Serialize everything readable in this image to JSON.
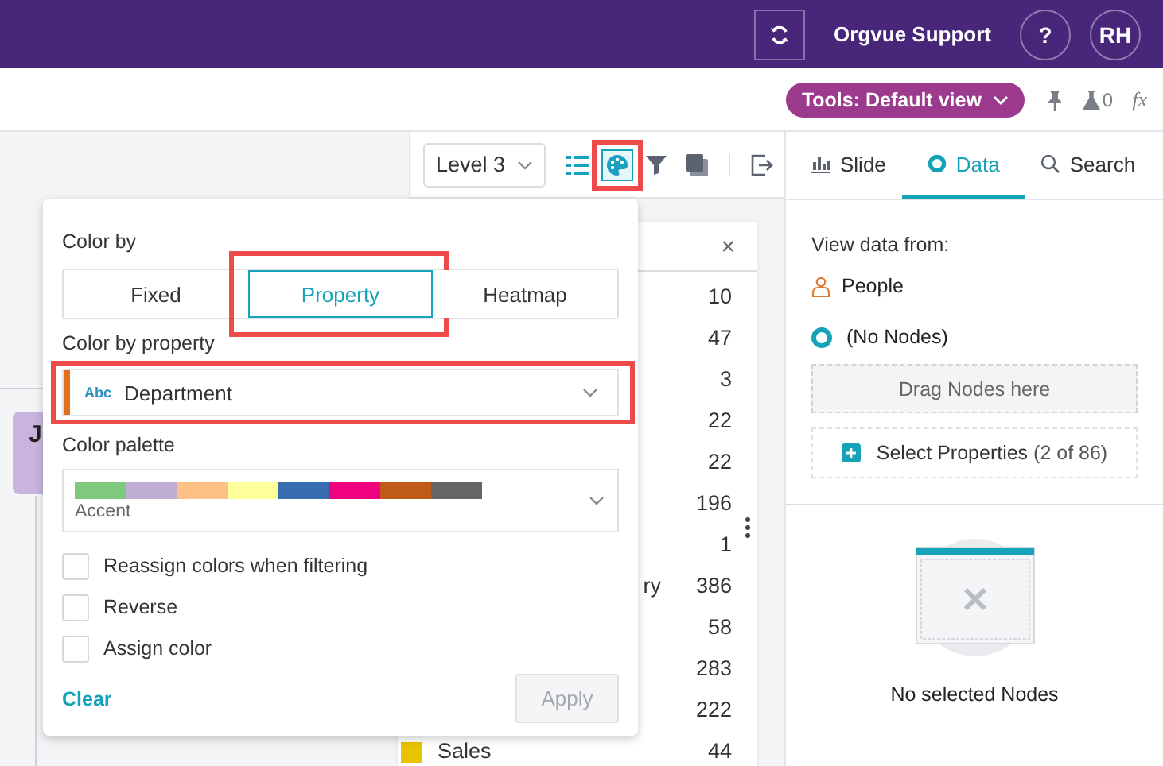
{
  "header": {
    "support": "Orgvue Support",
    "help": "?",
    "avatar": "RH"
  },
  "subbar": {
    "tools": "Tools: Default view",
    "beaker_count": "0",
    "fx": "fx"
  },
  "toolbar": {
    "level": "Level 3",
    "tools": [
      {
        "kind": "list",
        "selected": false,
        "highlighted": false
      },
      {
        "kind": "palette",
        "selected": true,
        "highlighted": true
      },
      {
        "kind": "filter",
        "selected": false,
        "highlighted": false
      },
      {
        "kind": "layers",
        "selected": false,
        "highlighted": false
      },
      {
        "kind": "export",
        "selected": false,
        "highlighted": false
      }
    ]
  },
  "canvas": {
    "card": {
      "title": "J"
    },
    "list": {
      "close": "×",
      "rows": [
        {
          "value": "10"
        },
        {
          "value": "47"
        },
        {
          "value": "3"
        },
        {
          "value": "22"
        },
        {
          "value": "22"
        },
        {
          "value": "196"
        },
        {
          "value": "1"
        },
        {
          "value": "386",
          "label": "ry"
        },
        {
          "value": "58"
        },
        {
          "value": "283"
        },
        {
          "value": "222"
        },
        {
          "value": "44",
          "label": "Sales",
          "color": "#e8c400"
        }
      ]
    }
  },
  "popup": {
    "color_by_label": "Color by",
    "modes": [
      {
        "label": "Fixed",
        "selected": false,
        "highlighted": false
      },
      {
        "label": "Property",
        "selected": true,
        "highlighted": true
      },
      {
        "label": "Heatmap",
        "selected": false,
        "highlighted": false
      }
    ],
    "property_label": "Color by property",
    "property": {
      "type_tag": "Abc",
      "value": "Department",
      "color": "#e07020",
      "highlighted": true
    },
    "palette_label": "Color palette",
    "palette": {
      "name": "Accent",
      "swatches": [
        {
          "color": "#7fc97f"
        },
        {
          "color": "#beaed4"
        },
        {
          "color": "#fdc086"
        },
        {
          "color": "#ffff99"
        },
        {
          "color": "#386cb0"
        },
        {
          "color": "#f0027f"
        },
        {
          "color": "#bf5b17"
        },
        {
          "color": "#666666"
        }
      ]
    },
    "options": [
      {
        "label": "Reassign colors when filtering",
        "checked": false
      },
      {
        "label": "Reverse",
        "checked": false
      },
      {
        "label": "Assign color",
        "checked": false
      }
    ],
    "clear": "Clear",
    "apply": {
      "label": "Apply",
      "disabled": true
    }
  },
  "side_tabs": [
    {
      "label": "Slide",
      "kind": "chart",
      "selected": false
    },
    {
      "label": "Data",
      "kind": "ring",
      "selected": true
    },
    {
      "label": "Search",
      "kind": "search",
      "selected": false
    }
  ],
  "data_panel": {
    "heading": "View data from:",
    "source": "People",
    "nodes_option": {
      "label": "(No Nodes)",
      "selected": true
    },
    "drop_zone": "Drag Nodes here",
    "select_properties": "Select Properties",
    "properties_count": "(2 of 86)",
    "empty_message": "No selected Nodes"
  }
}
